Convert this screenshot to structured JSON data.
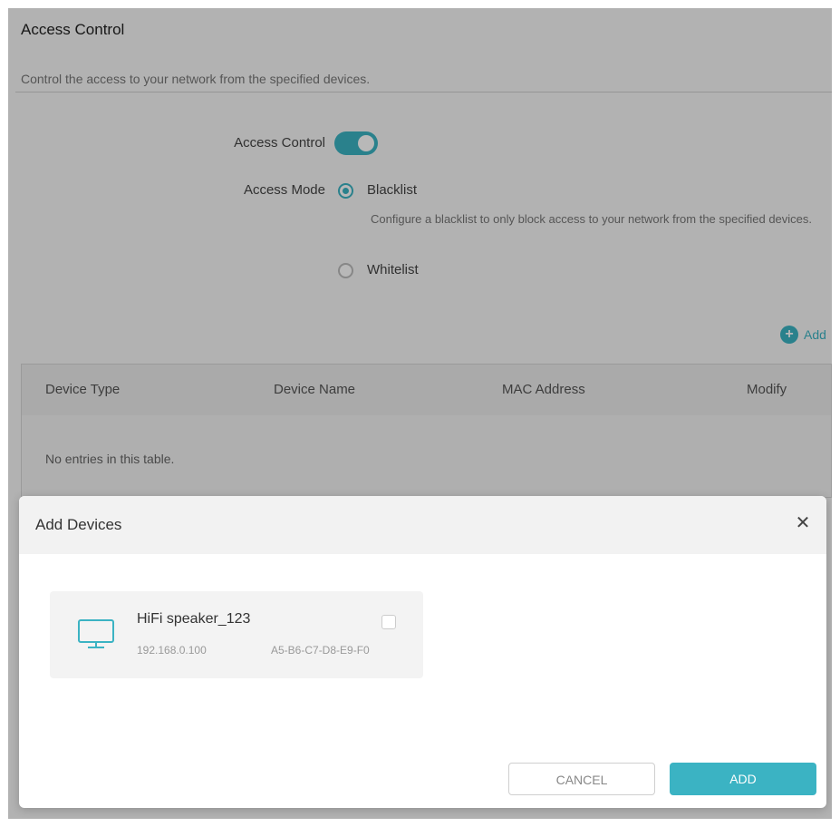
{
  "header": {
    "title": "Access Control",
    "description": "Control the access to your network from the specified devices."
  },
  "settings": {
    "access_control_label": "Access Control",
    "access_control_enabled": true,
    "access_mode_label": "Access Mode",
    "modes": [
      {
        "label": "Blacklist",
        "selected": true
      },
      {
        "label": "Whitelist",
        "selected": false
      }
    ],
    "blacklist_help": "Configure a blacklist to only block access to your network from the specified devices."
  },
  "toolbar": {
    "add_label": "Add"
  },
  "table": {
    "columns": [
      "Device Type",
      "Device Name",
      "MAC Address",
      "Modify"
    ],
    "empty_text": "No entries in this table."
  },
  "dialog": {
    "title": "Add Devices",
    "close_glyph": "✕",
    "devices": [
      {
        "name": "HiFi speaker_123",
        "ip": "192.168.0.100",
        "mac": "A5-B6-C7-D8-E9-F0",
        "icon": "monitor-icon"
      }
    ],
    "cancel_label": "CANCEL",
    "add_label": "ADD"
  },
  "colors": {
    "accent": "#3bb3c3"
  }
}
